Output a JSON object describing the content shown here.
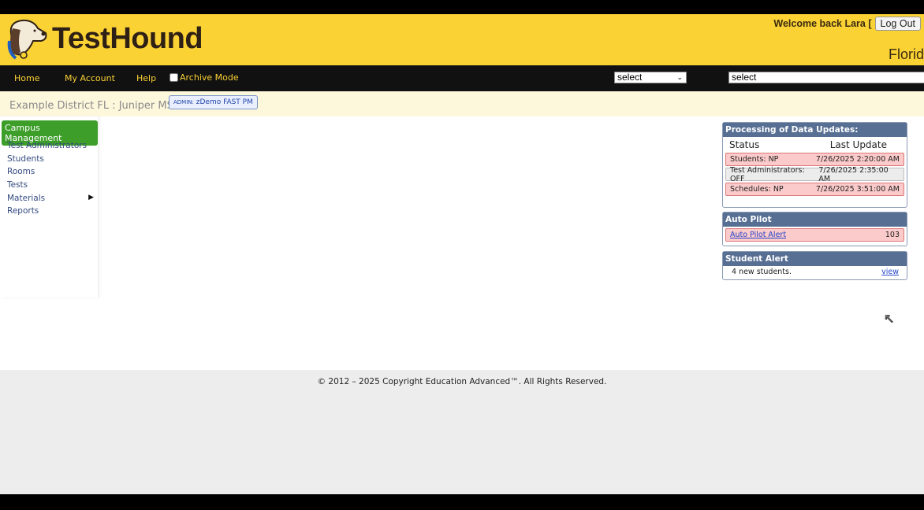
{
  "header": {
    "logo_text": "TestHound",
    "welcome": "Welcome back Lara [",
    "logout": "Log Out",
    "state": "Florid"
  },
  "nav": {
    "items": [
      "Home",
      "My Account",
      "Help"
    ],
    "archive_label": "Archive Mode",
    "select1": "select",
    "select2": "select"
  },
  "breadcrumb": {
    "district": "Example District FL : Juniper MS",
    "admin_prefix": "ADMIN:",
    "admin_name": "zDemo FAST PM"
  },
  "sidebar": {
    "title": "Campus Management",
    "items": [
      "Test Administrators",
      "Students",
      "Rooms",
      "Tests",
      "Materials",
      "Reports"
    ]
  },
  "processing": {
    "title": "Processing of Data Updates:",
    "col_status": "Status",
    "col_update": "Last Update",
    "rows": [
      {
        "status": "Students: NP",
        "time": "7/26/2025 2:20:00 AM"
      },
      {
        "status": "Test Administrators: OFF",
        "time": "7/26/2025 2:35:00 AM"
      },
      {
        "status": "Schedules: NP",
        "time": "7/26/2025 3:51:00 AM"
      }
    ]
  },
  "autopilot": {
    "title": "Auto Pilot",
    "alert": "Auto Pilot Alert",
    "count": "103"
  },
  "student_alert": {
    "title": "Student Alert",
    "text": "4 new students.",
    "link": "view"
  },
  "footer": {
    "copyright": "© 2012 – 2025 Copyright Education Advanced™. All Rights Reserved."
  }
}
